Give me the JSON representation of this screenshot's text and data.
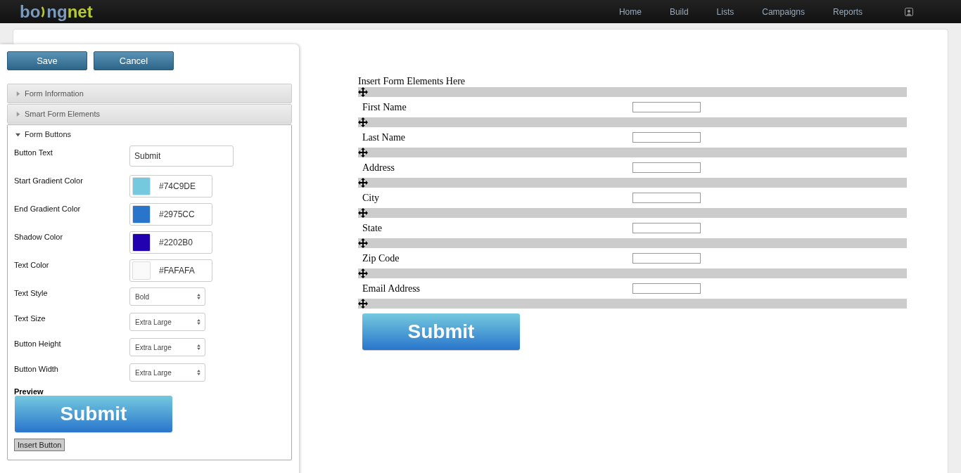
{
  "topbar": {
    "logo": {
      "dark": "bo",
      "mid": "ng",
      "accent": "net"
    },
    "nav": [
      "Home",
      "Build",
      "Lists",
      "Campaigns",
      "Reports"
    ]
  },
  "panel": {
    "buttons": [
      "Save",
      "Cancel"
    ],
    "sections": [
      {
        "title": "Form Information",
        "expanded": false
      },
      {
        "title": "Smart Form Elements",
        "expanded": false
      },
      {
        "title": "Form Buttons",
        "expanded": true
      }
    ],
    "fields": [
      {
        "kind": "text",
        "label": "Button Text",
        "value": "Submit"
      },
      {
        "kind": "color",
        "label": "Start Gradient  Color",
        "value": "#74C9DE"
      },
      {
        "kind": "color",
        "label": "End Gradient  Color",
        "value": "#2975CC"
      },
      {
        "kind": "color",
        "label": "Shadow Color",
        "value": "#2202B0"
      },
      {
        "kind": "color",
        "label": "Text Color",
        "value": "#FAFAFA"
      },
      {
        "kind": "select",
        "label": "Text Style",
        "value": "Bold"
      },
      {
        "kind": "select",
        "label": "Text Size",
        "value": "Extra Large"
      },
      {
        "kind": "select",
        "label": "Button Height",
        "value": "Extra Large"
      },
      {
        "kind": "select",
        "label": "Button Width",
        "value": "Extra Large"
      }
    ],
    "preview_label": "Preview",
    "preview_button": "Submit",
    "insert_button": "Insert Button"
  },
  "canvas": {
    "heading": "Insert Form Elements Here",
    "fields": [
      "First Name",
      "Last Name",
      "Address",
      "City",
      "State",
      "Zip Code",
      "Email Address"
    ],
    "submit_button": "Submit"
  }
}
